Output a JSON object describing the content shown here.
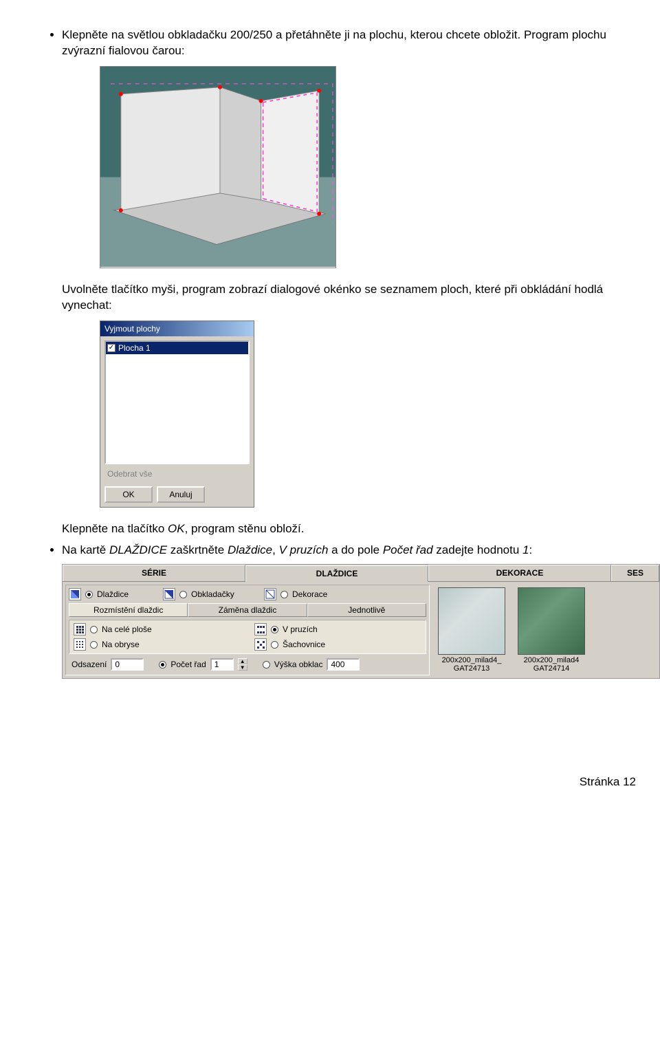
{
  "bullets": {
    "b1_a": "Klepněte na světlou obkladačku 200/250 a přetáhněte ji na plochu, kterou chcete obložit. Program plochu zvýrazní fialovou čarou:",
    "b1_b": "Uvolněte tlačítko myši, program zobrazí dialogové okénko se seznamem ploch, které při obkládání hodlá vynechat:",
    "b1_c_pre": "Klepněte na tlačítko ",
    "b1_c_ok": "OK",
    "b1_c_post": ", program stěnu obloží.",
    "b2_pre": "Na kartě ",
    "b2_tab": "DLAŽDICE",
    "b2_mid1": " zaškrtněte ",
    "b2_i1": "Dlaždice",
    "b2_mid2": ", ",
    "b2_i2": "V pruzích",
    "b2_mid3": " a do pole ",
    "b2_i3": "Počet řad",
    "b2_mid4": " zadejte hodnotu ",
    "b2_i4": "1",
    "b2_post": ":"
  },
  "dialog": {
    "title": "Vyjmout plochy",
    "item1": "Plocha 1",
    "remove_all": "Odebrat vše",
    "ok": "OK",
    "cancel": "Anuluj"
  },
  "panel": {
    "tabs": {
      "serie": "SÉRIE",
      "dlazdice": "DLAŽDICE",
      "dekorace": "DEKORACE",
      "ses": "SES"
    },
    "radios": {
      "dlazdice": "Dlaždice",
      "obkladacky": "Obkladačky",
      "dekorace": "Dekorace"
    },
    "subtabs": {
      "rozmisteni": "Rozmístění dlaždic",
      "zamena": "Záměna dlaždic",
      "jednotlive": "Jednotlivě"
    },
    "opts": {
      "cela": "Na celé ploše",
      "pruzy": "V pruzích",
      "obrys": "Na obryse",
      "sach": "Šachovnice"
    },
    "bottom": {
      "odsazeni": "Odsazení",
      "odsazeni_v": "0",
      "pocet": "Počet řad",
      "pocet_v": "1",
      "vyska": "Výška obklac",
      "vyska_v": "400"
    },
    "swatches": {
      "a1": "200x200_milad4_",
      "a2": "GAT24713",
      "b1": "200x200_milad4",
      "b2": "GAT24714"
    }
  },
  "footer": "Stránka 12"
}
